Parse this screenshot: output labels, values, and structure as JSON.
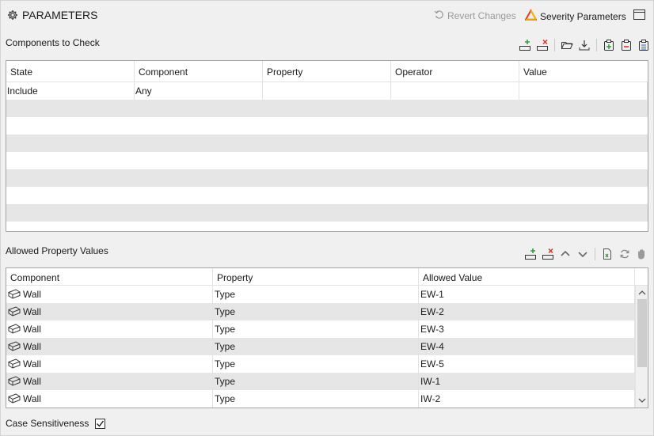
{
  "header": {
    "title": "PARAMETERS",
    "revert_label": "Revert Changes",
    "severity_label": "Severity Parameters"
  },
  "components": {
    "label": "Components to Check",
    "columns": [
      "State",
      "Component",
      "Property",
      "Operator",
      "Value"
    ],
    "rows": [
      {
        "state": "Include",
        "component": "Any",
        "property": "",
        "operator": "",
        "value": ""
      }
    ]
  },
  "allowed": {
    "label": "Allowed Property Values",
    "columns": [
      "Component",
      "Property",
      "Allowed Value"
    ],
    "rows": [
      {
        "component": "Wall",
        "property": "Type",
        "value": "EW-1"
      },
      {
        "component": "Wall",
        "property": "Type",
        "value": "EW-2"
      },
      {
        "component": "Wall",
        "property": "Type",
        "value": "EW-3"
      },
      {
        "component": "Wall",
        "property": "Type",
        "value": "EW-4"
      },
      {
        "component": "Wall",
        "property": "Type",
        "value": "EW-5"
      },
      {
        "component": "Wall",
        "property": "Type",
        "value": "IW-1"
      },
      {
        "component": "Wall",
        "property": "Type",
        "value": "IW-2"
      }
    ]
  },
  "case_sensitiveness": {
    "label": "Case Sensitiveness",
    "checked": true
  },
  "icons": {
    "settings": "gear-icon",
    "revert": "undo-icon",
    "severity": "warning-triangle-icon",
    "window": "window-icon",
    "wall": "wall-cube-icon"
  },
  "colors": {
    "background": "#f0f0f0",
    "row_alt": "#e6e6e6",
    "add_green": "#2e9e3c",
    "remove_red": "#d9342b",
    "severity_red": "#e53b2f",
    "severity_yellow": "#f2b705"
  }
}
